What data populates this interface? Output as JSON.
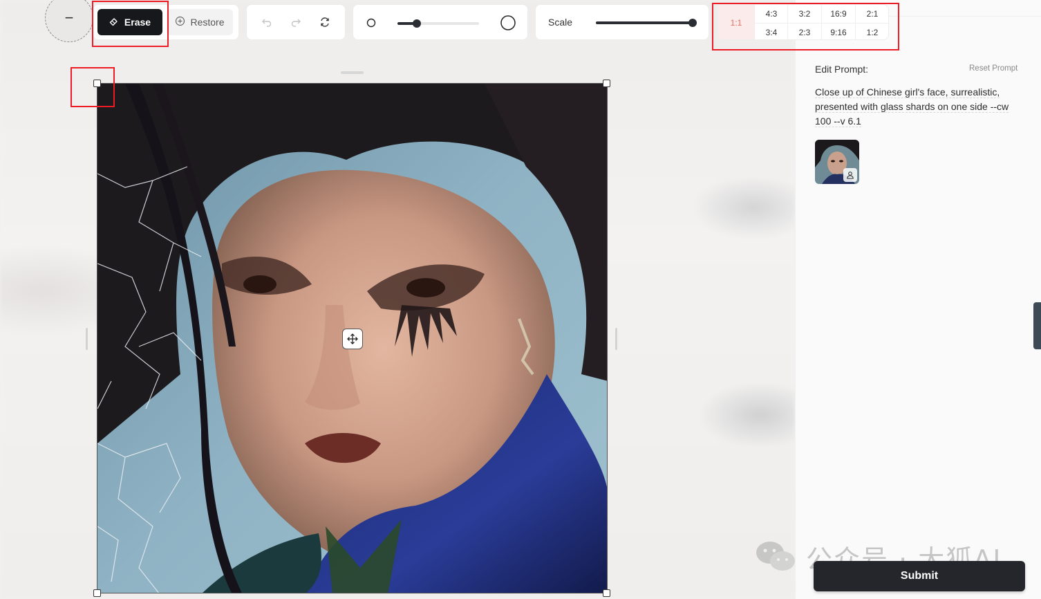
{
  "toolbar": {
    "brush_preview_symbol": "−",
    "erase_label": "Erase",
    "restore_label": "Restore",
    "brush_size_level": 0.24,
    "scale_label": "Scale",
    "scale_level": 0.97,
    "aspect_ratios": {
      "active": "1:1",
      "row1": [
        "4:3",
        "3:2",
        "16:9",
        "2:1"
      ],
      "row2": [
        "3:4",
        "2:3",
        "9:16",
        "1:2"
      ]
    }
  },
  "panel": {
    "edit_prompt_label": "Edit Prompt:",
    "reset_prompt_label": "Reset Prompt",
    "prompt_lines": [
      "Close up of Chinese girl's face, surrealistic,",
      "presented with glass shards on one side --cw",
      "100 --v 6.1"
    ],
    "submit_label": "Submit"
  },
  "watermark": {
    "text": "公众号 · 大狐AI"
  },
  "icons": {
    "erase": "eraser-icon",
    "restore": "plus-circle-icon",
    "undo": "undo-icon",
    "redo": "redo-icon",
    "reset": "refresh-icon",
    "move": "move-arrows-icon",
    "thumb_badge": "person-icon"
  },
  "colors": {
    "accent_dark": "#17181b",
    "ratio_active_bg": "#fbeceb",
    "ratio_active_text": "#e36d5e",
    "highlight": "#ec1b24",
    "submit_bg": "#24262b"
  }
}
